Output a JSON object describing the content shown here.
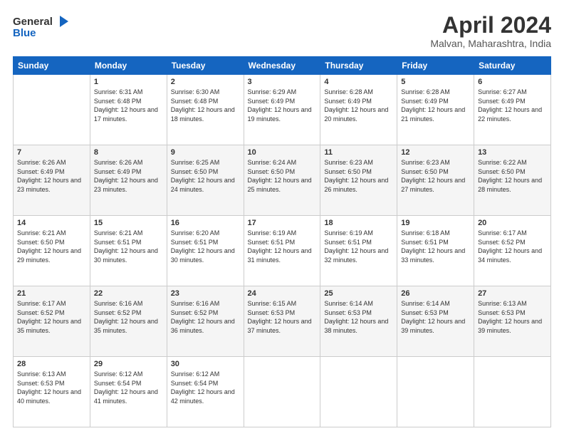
{
  "header": {
    "logo_line1": "General",
    "logo_line2": "Blue",
    "title": "April 2024",
    "location": "Malvan, Maharashtra, India"
  },
  "columns": [
    "Sunday",
    "Monday",
    "Tuesday",
    "Wednesday",
    "Thursday",
    "Friday",
    "Saturday"
  ],
  "weeks": [
    [
      {
        "day": "",
        "sunrise": "",
        "sunset": "",
        "daylight": ""
      },
      {
        "day": "1",
        "sunrise": "Sunrise: 6:31 AM",
        "sunset": "Sunset: 6:48 PM",
        "daylight": "Daylight: 12 hours and 17 minutes."
      },
      {
        "day": "2",
        "sunrise": "Sunrise: 6:30 AM",
        "sunset": "Sunset: 6:48 PM",
        "daylight": "Daylight: 12 hours and 18 minutes."
      },
      {
        "day": "3",
        "sunrise": "Sunrise: 6:29 AM",
        "sunset": "Sunset: 6:49 PM",
        "daylight": "Daylight: 12 hours and 19 minutes."
      },
      {
        "day": "4",
        "sunrise": "Sunrise: 6:28 AM",
        "sunset": "Sunset: 6:49 PM",
        "daylight": "Daylight: 12 hours and 20 minutes."
      },
      {
        "day": "5",
        "sunrise": "Sunrise: 6:28 AM",
        "sunset": "Sunset: 6:49 PM",
        "daylight": "Daylight: 12 hours and 21 minutes."
      },
      {
        "day": "6",
        "sunrise": "Sunrise: 6:27 AM",
        "sunset": "Sunset: 6:49 PM",
        "daylight": "Daylight: 12 hours and 22 minutes."
      }
    ],
    [
      {
        "day": "7",
        "sunrise": "Sunrise: 6:26 AM",
        "sunset": "Sunset: 6:49 PM",
        "daylight": "Daylight: 12 hours and 23 minutes."
      },
      {
        "day": "8",
        "sunrise": "Sunrise: 6:26 AM",
        "sunset": "Sunset: 6:49 PM",
        "daylight": "Daylight: 12 hours and 23 minutes."
      },
      {
        "day": "9",
        "sunrise": "Sunrise: 6:25 AM",
        "sunset": "Sunset: 6:50 PM",
        "daylight": "Daylight: 12 hours and 24 minutes."
      },
      {
        "day": "10",
        "sunrise": "Sunrise: 6:24 AM",
        "sunset": "Sunset: 6:50 PM",
        "daylight": "Daylight: 12 hours and 25 minutes."
      },
      {
        "day": "11",
        "sunrise": "Sunrise: 6:23 AM",
        "sunset": "Sunset: 6:50 PM",
        "daylight": "Daylight: 12 hours and 26 minutes."
      },
      {
        "day": "12",
        "sunrise": "Sunrise: 6:23 AM",
        "sunset": "Sunset: 6:50 PM",
        "daylight": "Daylight: 12 hours and 27 minutes."
      },
      {
        "day": "13",
        "sunrise": "Sunrise: 6:22 AM",
        "sunset": "Sunset: 6:50 PM",
        "daylight": "Daylight: 12 hours and 28 minutes."
      }
    ],
    [
      {
        "day": "14",
        "sunrise": "Sunrise: 6:21 AM",
        "sunset": "Sunset: 6:50 PM",
        "daylight": "Daylight: 12 hours and 29 minutes."
      },
      {
        "day": "15",
        "sunrise": "Sunrise: 6:21 AM",
        "sunset": "Sunset: 6:51 PM",
        "daylight": "Daylight: 12 hours and 30 minutes."
      },
      {
        "day": "16",
        "sunrise": "Sunrise: 6:20 AM",
        "sunset": "Sunset: 6:51 PM",
        "daylight": "Daylight: 12 hours and 30 minutes."
      },
      {
        "day": "17",
        "sunrise": "Sunrise: 6:19 AM",
        "sunset": "Sunset: 6:51 PM",
        "daylight": "Daylight: 12 hours and 31 minutes."
      },
      {
        "day": "18",
        "sunrise": "Sunrise: 6:19 AM",
        "sunset": "Sunset: 6:51 PM",
        "daylight": "Daylight: 12 hours and 32 minutes."
      },
      {
        "day": "19",
        "sunrise": "Sunrise: 6:18 AM",
        "sunset": "Sunset: 6:51 PM",
        "daylight": "Daylight: 12 hours and 33 minutes."
      },
      {
        "day": "20",
        "sunrise": "Sunrise: 6:17 AM",
        "sunset": "Sunset: 6:52 PM",
        "daylight": "Daylight: 12 hours and 34 minutes."
      }
    ],
    [
      {
        "day": "21",
        "sunrise": "Sunrise: 6:17 AM",
        "sunset": "Sunset: 6:52 PM",
        "daylight": "Daylight: 12 hours and 35 minutes."
      },
      {
        "day": "22",
        "sunrise": "Sunrise: 6:16 AM",
        "sunset": "Sunset: 6:52 PM",
        "daylight": "Daylight: 12 hours and 35 minutes."
      },
      {
        "day": "23",
        "sunrise": "Sunrise: 6:16 AM",
        "sunset": "Sunset: 6:52 PM",
        "daylight": "Daylight: 12 hours and 36 minutes."
      },
      {
        "day": "24",
        "sunrise": "Sunrise: 6:15 AM",
        "sunset": "Sunset: 6:53 PM",
        "daylight": "Daylight: 12 hours and 37 minutes."
      },
      {
        "day": "25",
        "sunrise": "Sunrise: 6:14 AM",
        "sunset": "Sunset: 6:53 PM",
        "daylight": "Daylight: 12 hours and 38 minutes."
      },
      {
        "day": "26",
        "sunrise": "Sunrise: 6:14 AM",
        "sunset": "Sunset: 6:53 PM",
        "daylight": "Daylight: 12 hours and 39 minutes."
      },
      {
        "day": "27",
        "sunrise": "Sunrise: 6:13 AM",
        "sunset": "Sunset: 6:53 PM",
        "daylight": "Daylight: 12 hours and 39 minutes."
      }
    ],
    [
      {
        "day": "28",
        "sunrise": "Sunrise: 6:13 AM",
        "sunset": "Sunset: 6:53 PM",
        "daylight": "Daylight: 12 hours and 40 minutes."
      },
      {
        "day": "29",
        "sunrise": "Sunrise: 6:12 AM",
        "sunset": "Sunset: 6:54 PM",
        "daylight": "Daylight: 12 hours and 41 minutes."
      },
      {
        "day": "30",
        "sunrise": "Sunrise: 6:12 AM",
        "sunset": "Sunset: 6:54 PM",
        "daylight": "Daylight: 12 hours and 42 minutes."
      },
      {
        "day": "",
        "sunrise": "",
        "sunset": "",
        "daylight": ""
      },
      {
        "day": "",
        "sunrise": "",
        "sunset": "",
        "daylight": ""
      },
      {
        "day": "",
        "sunrise": "",
        "sunset": "",
        "daylight": ""
      },
      {
        "day": "",
        "sunrise": "",
        "sunset": "",
        "daylight": ""
      }
    ]
  ]
}
